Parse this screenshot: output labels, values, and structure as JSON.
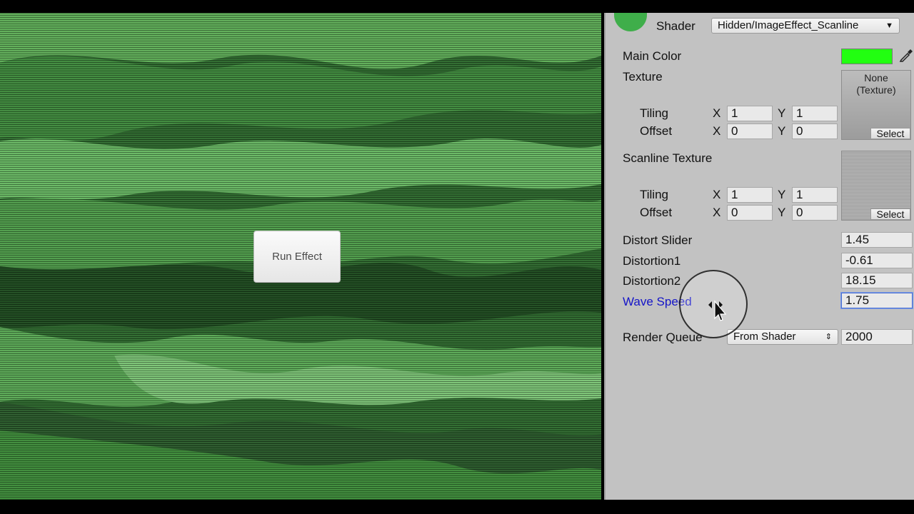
{
  "scene": {
    "run_button": "Run Effect"
  },
  "inspector": {
    "shader_label": "Shader",
    "shader_value": "Hidden/ImageEffect_Scanline",
    "main_color_label": "Main Color",
    "main_color_value": "#22ff11",
    "texture": {
      "label": "Texture",
      "preview": "None\n(Texture)",
      "select": "Select",
      "tiling_label": "Tiling",
      "offset_label": "Offset",
      "x_label": "X",
      "y_label": "Y",
      "tiling_x": "1",
      "tiling_y": "1",
      "offset_x": "0",
      "offset_y": "0"
    },
    "scanline_texture": {
      "label": "Scanline Texture",
      "select": "Select",
      "tiling_label": "Tiling",
      "offset_label": "Offset",
      "x_label": "X",
      "y_label": "Y",
      "tiling_x": "1",
      "tiling_y": "1",
      "offset_x": "0",
      "offset_y": "0"
    },
    "distort_slider_label": "Distort Slider",
    "distort_slider_value": "1.45",
    "distortion1_label": "Distortion1",
    "distortion1_value": "-0.61",
    "distortion2_label": "Distortion2",
    "distortion2_value": "18.15",
    "wave_speed_label": "Wave Speed",
    "wave_speed_value": "1.75",
    "render_queue_label": "Render Queue",
    "render_queue_mode": "From Shader",
    "render_queue_value": "2000"
  },
  "colors": {
    "accent": "#1414c8",
    "scene_green": "#4c9a4c"
  }
}
